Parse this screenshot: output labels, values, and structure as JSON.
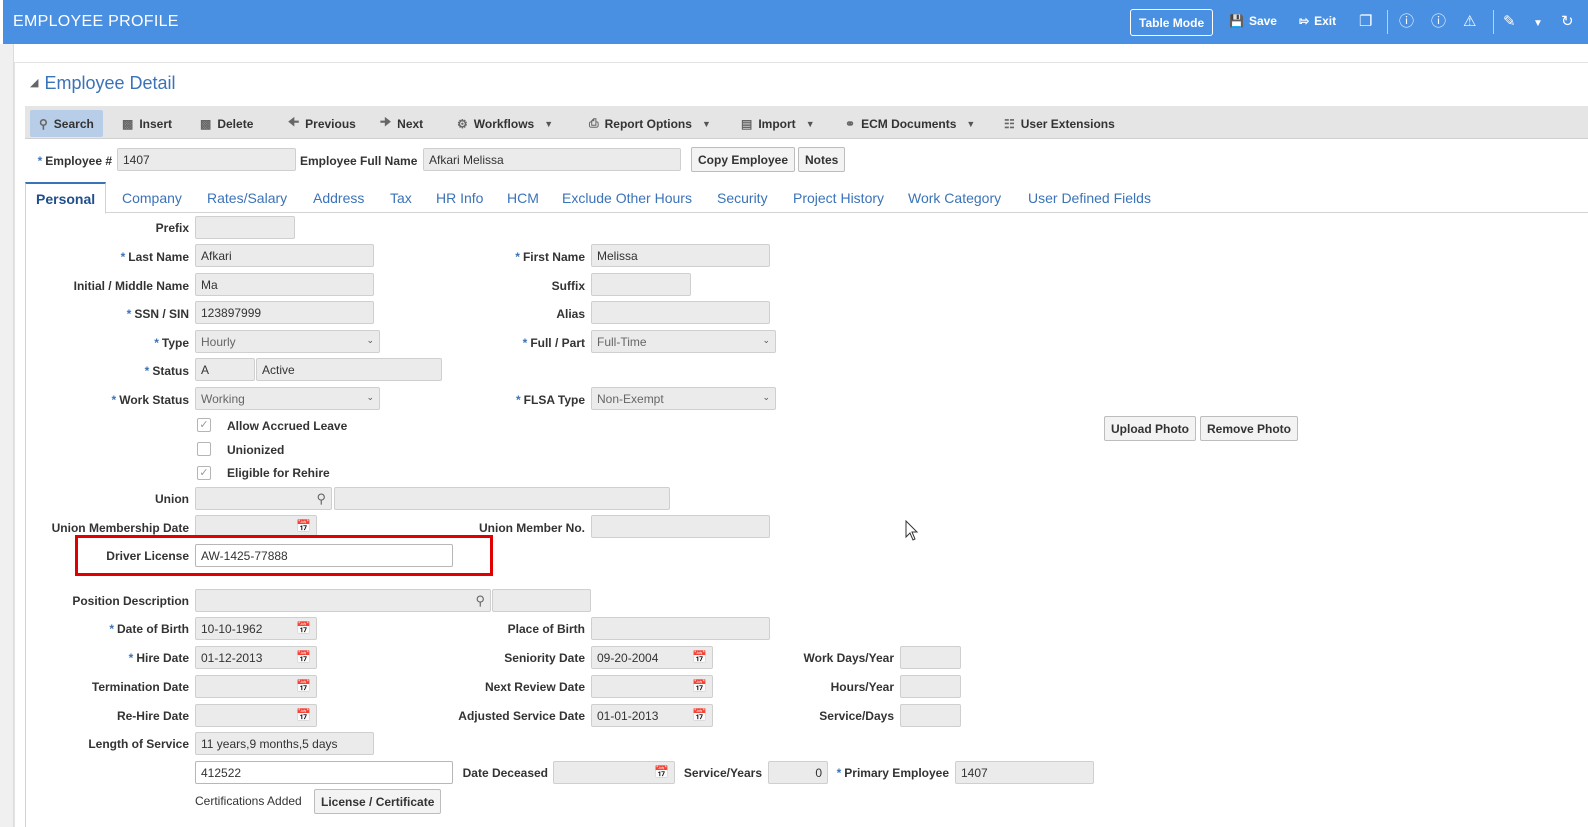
{
  "header": {
    "title": "EMPLOYEE PROFILE",
    "table_mode": "Table Mode",
    "save": "Save",
    "exit": "Exit"
  },
  "panel": {
    "title": "Employee Detail"
  },
  "toolbar": {
    "search": "Search",
    "insert": "Insert",
    "delete": "Delete",
    "previous": "Previous",
    "next": "Next",
    "workflows": "Workflows",
    "report_options": "Report Options",
    "import": "Import",
    "ecm_documents": "ECM Documents",
    "user_extensions": "User Extensions"
  },
  "employee_bar": {
    "employee_no_label": "Employee #",
    "employee_no": "1407",
    "full_name_label": "Employee Full Name",
    "full_name": "Afkari Melissa",
    "copy_employee": "Copy Employee",
    "notes": "Notes"
  },
  "tabs": [
    "Personal",
    "Company",
    "Rates/Salary",
    "Address",
    "Tax",
    "HR Info",
    "HCM",
    "Exclude Other Hours",
    "Security",
    "Project History",
    "Work Category",
    "User Defined Fields"
  ],
  "form": {
    "prefix_label": "Prefix",
    "prefix": "",
    "last_name_label": "Last Name",
    "last_name": "Afkari",
    "first_name_label": "First Name",
    "first_name": "Melissa",
    "middle_label": "Initial / Middle Name",
    "middle": "Ma",
    "suffix_label": "Suffix",
    "suffix": "",
    "ssn_label": "SSN / SIN",
    "ssn": "123897999",
    "alias_label": "Alias",
    "alias": "",
    "type_label": "Type",
    "type": "Hourly",
    "full_part_label": "Full / Part",
    "full_part": "Full-Time",
    "status_label": "Status",
    "status_code": "A",
    "status_text": "Active",
    "work_status_label": "Work Status",
    "work_status": "Working",
    "flsa_label": "FLSA Type",
    "flsa": "Non-Exempt",
    "allow_accrued_label": "Allow Accrued Leave",
    "unionized_label": "Unionized",
    "eligible_rehire_label": "Eligible for Rehire",
    "union_label": "Union",
    "union_member_date_label": "Union Membership Date",
    "union_member_no_label": "Union Member No.",
    "driver_license_label": "Driver License",
    "driver_license": "AW-1425-77888",
    "position_desc_label": "Position Description",
    "dob_label": "Date of Birth",
    "dob": "10-10-1962",
    "place_of_birth_label": "Place of Birth",
    "hire_date_label": "Hire Date",
    "hire_date": "01-12-2013",
    "seniority_date_label": "Seniority Date",
    "seniority_date": "09-20-2004",
    "work_days_label": "Work Days/Year",
    "termination_label": "Termination Date",
    "next_review_label": "Next Review Date",
    "hours_year_label": "Hours/Year",
    "rehire_label": "Re-Hire Date",
    "adjusted_service_label": "Adjusted Service Date",
    "adjusted_service": "01-01-2013",
    "service_days_label": "Service/Days",
    "length_service_label": "Length of Service",
    "length_service": "11 years,9 months,5 days",
    "misc_value": "412522",
    "date_deceased_label": "Date Deceased",
    "service_years_label": "Service/Years",
    "service_years": "0",
    "primary_employee_label": "Primary Employee",
    "primary_employee": "1407",
    "certifications_label": "Certifications Added",
    "license_certificate": "License / Certificate",
    "upload_photo": "Upload Photo",
    "remove_photo": "Remove Photo"
  }
}
